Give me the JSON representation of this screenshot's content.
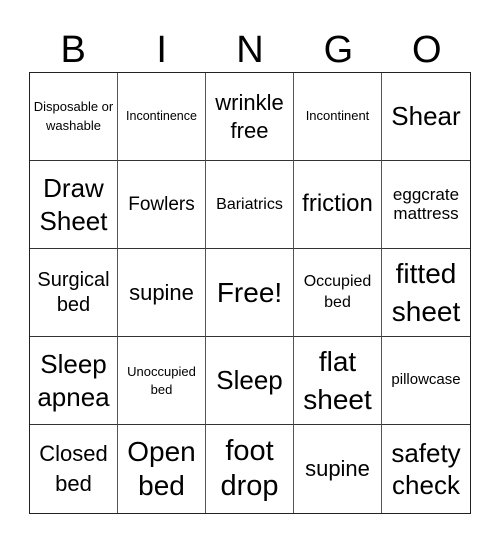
{
  "header": [
    "B",
    "I",
    "N",
    "G",
    "O"
  ],
  "cells": [
    "Disposable or washable",
    "Incontinence",
    "wrinkle free",
    "Incontinent",
    "Shear",
    "Draw Sheet",
    "Fowlers",
    "Bariatrics",
    "friction",
    "eggcrate mattress",
    "Surgical bed",
    "supine",
    "Free!",
    "Occupied bed",
    "fitted sheet",
    "Sleep apnea",
    "Unoccupied bed",
    "Sleep",
    "flat sheet",
    "pillowcase",
    "Closed bed",
    "Open bed",
    "foot drop",
    "supine",
    "safety check"
  ]
}
